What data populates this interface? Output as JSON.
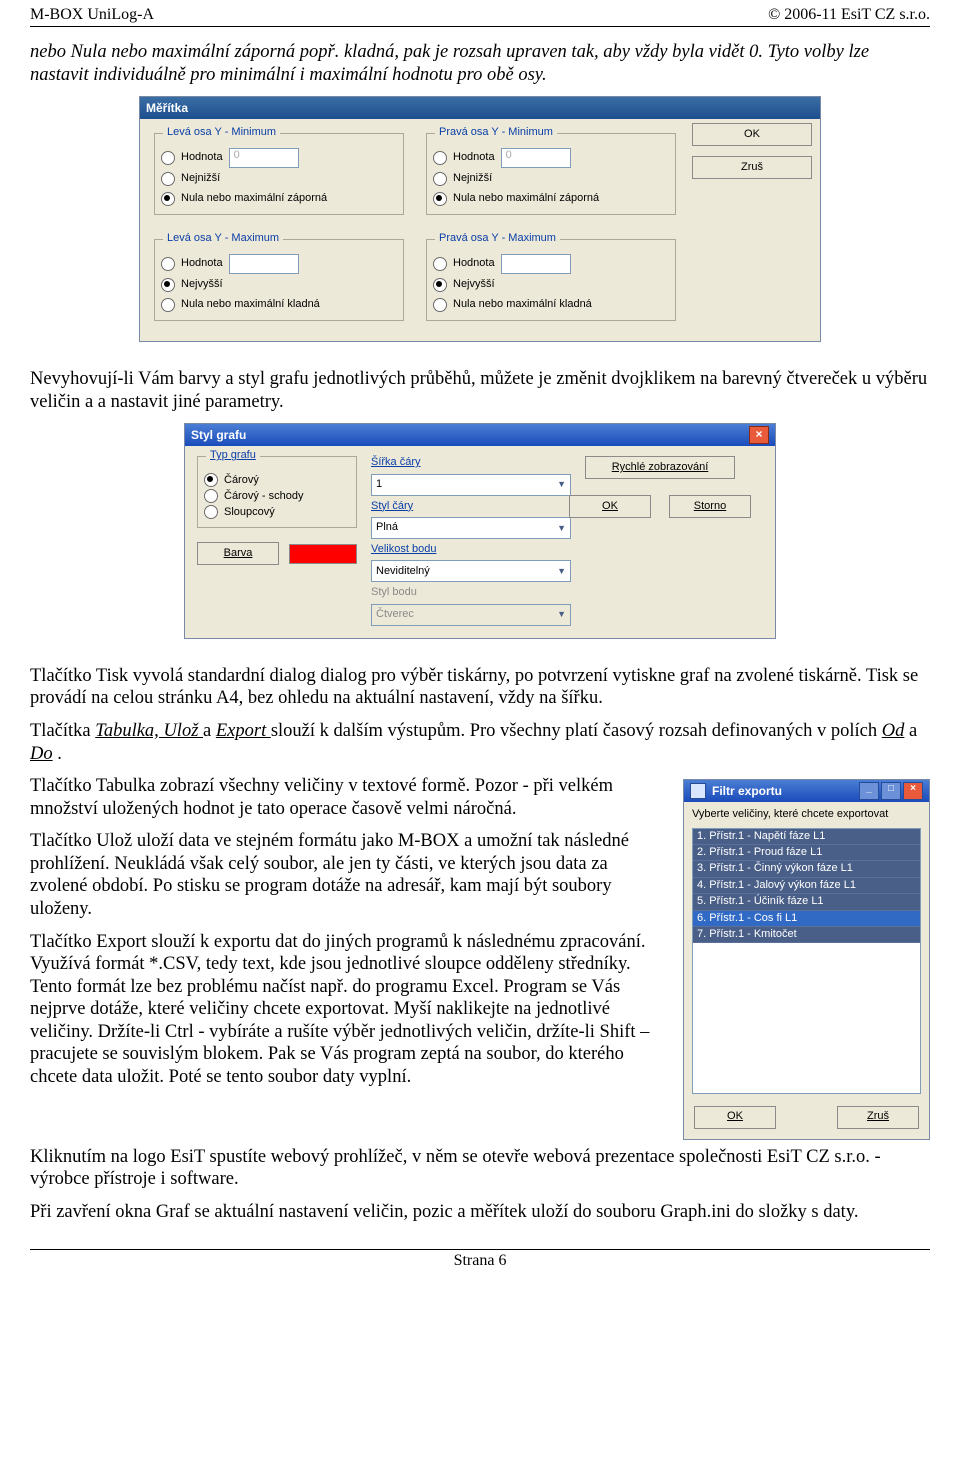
{
  "header": {
    "left": "M-BOX UniLog-A",
    "right": "© 2006-11 EsiT CZ s.r.o."
  },
  "p1": "nebo Nula nebo maximální záporná popř. kladná, pak je rozsah upraven tak, aby vždy byla vidět 0. Tyto volby lze nastavit individuálně pro minimální i maximální hodnotu pro obě osy.",
  "meritka": {
    "title": "Měřítka",
    "groups": {
      "leftMin": {
        "legend": "Levá osa Y - Minimum",
        "opt1": "Hodnota",
        "val1": "0",
        "opt2": "Nejnižší",
        "opt3": "Nula nebo maximální záporná"
      },
      "leftMax": {
        "legend": "Levá osa Y - Maximum",
        "opt1": "Hodnota",
        "val1": "",
        "opt2": "Nejvyšší",
        "opt3": "Nula nebo maximální kladná"
      },
      "rightMin": {
        "legend": "Pravá osa Y - Minimum",
        "opt1": "Hodnota",
        "val1": "0",
        "opt2": "Nejnižší",
        "opt3": "Nula nebo maximální záporná"
      },
      "rightMax": {
        "legend": "Pravá osa Y - Maximum",
        "opt1": "Hodnota",
        "val1": "",
        "opt2": "Nejvyšší",
        "opt3": "Nula nebo maximální kladná"
      }
    },
    "ok": "OK",
    "cancel": "Zruš"
  },
  "p2": "Nevyhovují-li Vám barvy a styl grafu jednotlivých průběhů, můžete je změnit dvojklikem na barevný čtvereček u výběru veličin a a nastavit jiné parametry.",
  "styl": {
    "title": "Styl grafu",
    "typGrafu": "Typ grafu",
    "r1": "Čárový",
    "r2": "Čárový - schody",
    "r3": "Sloupcový",
    "f1lbl": "Šířka čáry",
    "f1val": "1",
    "f2lbl": "Styl čáry",
    "f2val": "Plná",
    "f3lbl": "Velikost bodu",
    "f3val": "Neviditelný",
    "f4lbl": "Styl bodu",
    "f4val": "Čtverec",
    "barva": "Barva",
    "rychle": "Rychlé zobrazování",
    "ok": "OK",
    "storno": "Storno"
  },
  "p3a": "Tlačítko Tisk vyvolá standardní dialog dialog pro výběr tiskárny, po potvrzení vytiskne graf na zvolené tiskárně. Tisk se provádí na celou stránku A4, bez ohledu na aktuální nastavení, vždy na šířku.",
  "p3b_pre": "Tlačítka ",
  "p3b_tabulka": "Tabulka, ",
  "p3b_uloz": "Ulož ",
  "p3b_a": "a ",
  "p3b_export": "Export ",
  "p3b_mid": "slouží k dalším výstupům. Pro všechny platí časový rozsah definovaných v polích ",
  "p3b_od": "Od",
  "p3b_a2": " a ",
  "p3b_do": "Do",
  "p3b_end": ".",
  "p4": "Tlačítko Tabulka zobrazí všechny veličiny v textové formě. Pozor - při velkém množství uložených hodnot je tato operace časově velmi náročná.",
  "p5": "Tlačítko Ulož uloží data ve stejném formátu jako M-BOX a umožní tak následné prohlížení. Neukládá však celý soubor, ale jen ty části, ve kterých jsou data za zvolené období. Po stisku se program dotáže na adresář, kam mají být soubory uloženy.",
  "p6": "Tlačítko Export slouží k exportu dat do jiných programů k následnému zpracování. Využívá formát *.CSV, tedy text, kde jsou jednotlivé sloupce odděleny středníky. Tento formát lze bez problému načíst např. do programu Excel. Program se Vás nejprve dotáže, které veličiny chcete exportovat. Myší naklikejte na jednotlivé veličiny. Držíte-li Ctrl - vybíráte a rušíte výběr jednotlivých veličin, držíte-li Shift – pracujete se souvislým blokem. Pak se Vás program zeptá na soubor, do kterého chcete data uložit. Poté se tento soubor daty vyplní.",
  "filtr": {
    "title": "Filtr exportu",
    "label": "Vyberte veličiny, které chcete exportovat",
    "items": [
      "1.   Přístr.1 - Napětí fáze L1",
      "2.   Přístr.1 - Proud fáze L1",
      "3.   Přístr.1 - Činný výkon fáze L1",
      "4.   Přístr.1 - Jalový výkon fáze L1",
      "5.   Přístr.1 - Účiník fáze L1",
      "6.   Přístr.1 - Cos fi L1",
      "7.   Přístr.1 - Kmitočet"
    ],
    "ok": "OK",
    "zrus": "Zruš"
  },
  "p7": "Kliknutím na logo EsiT spustíte webový prohlížeč, v něm se otevře webová prezentace společnosti EsiT CZ s.r.o. - výrobce přístroje i software.",
  "p8": "Při zavření okna Graf se aktuální nastavení veličin, pozic a měřítek uloží do souboru Graph.ini do složky s daty.",
  "footer": "Strana 6"
}
